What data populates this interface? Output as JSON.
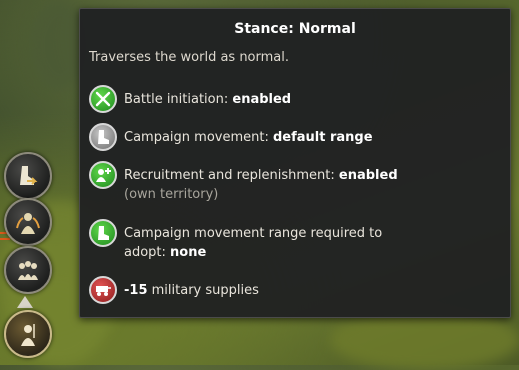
{
  "tooltip": {
    "title": "Stance: Normal",
    "description": "Traverses the world as normal.",
    "rows": [
      {
        "icon": "crossed-swords-icon",
        "label": "Battle initiation: ",
        "value": "enabled",
        "sub": ""
      },
      {
        "icon": "boot-icon",
        "label": "Campaign movement: ",
        "value": "default range",
        "sub": ""
      },
      {
        "icon": "recruitment-icon",
        "label": "Recruitment and replenishment: ",
        "value": "enabled",
        "sub": "(own territory)"
      },
      {
        "icon": "boot-icon",
        "label": "Campaign movement range required to adopt: ",
        "value": "none",
        "sub": ""
      },
      {
        "icon": "supply-cart-icon",
        "label": " military supplies",
        "value": "-15",
        "sub": ""
      }
    ]
  },
  "stances": [
    {
      "icon": "march-stance-icon",
      "active": false
    },
    {
      "icon": "raid-stance-icon",
      "active": false
    },
    {
      "icon": "muster-stance-icon",
      "active": false
    },
    {
      "icon": "normal-stance-icon",
      "active": true
    }
  ],
  "colors": {
    "enabled_icon": "#3cb043",
    "movement_icon": "#9a9a9a",
    "supplies_icon": "#c0392b",
    "tooltip_bg": "#202122"
  }
}
